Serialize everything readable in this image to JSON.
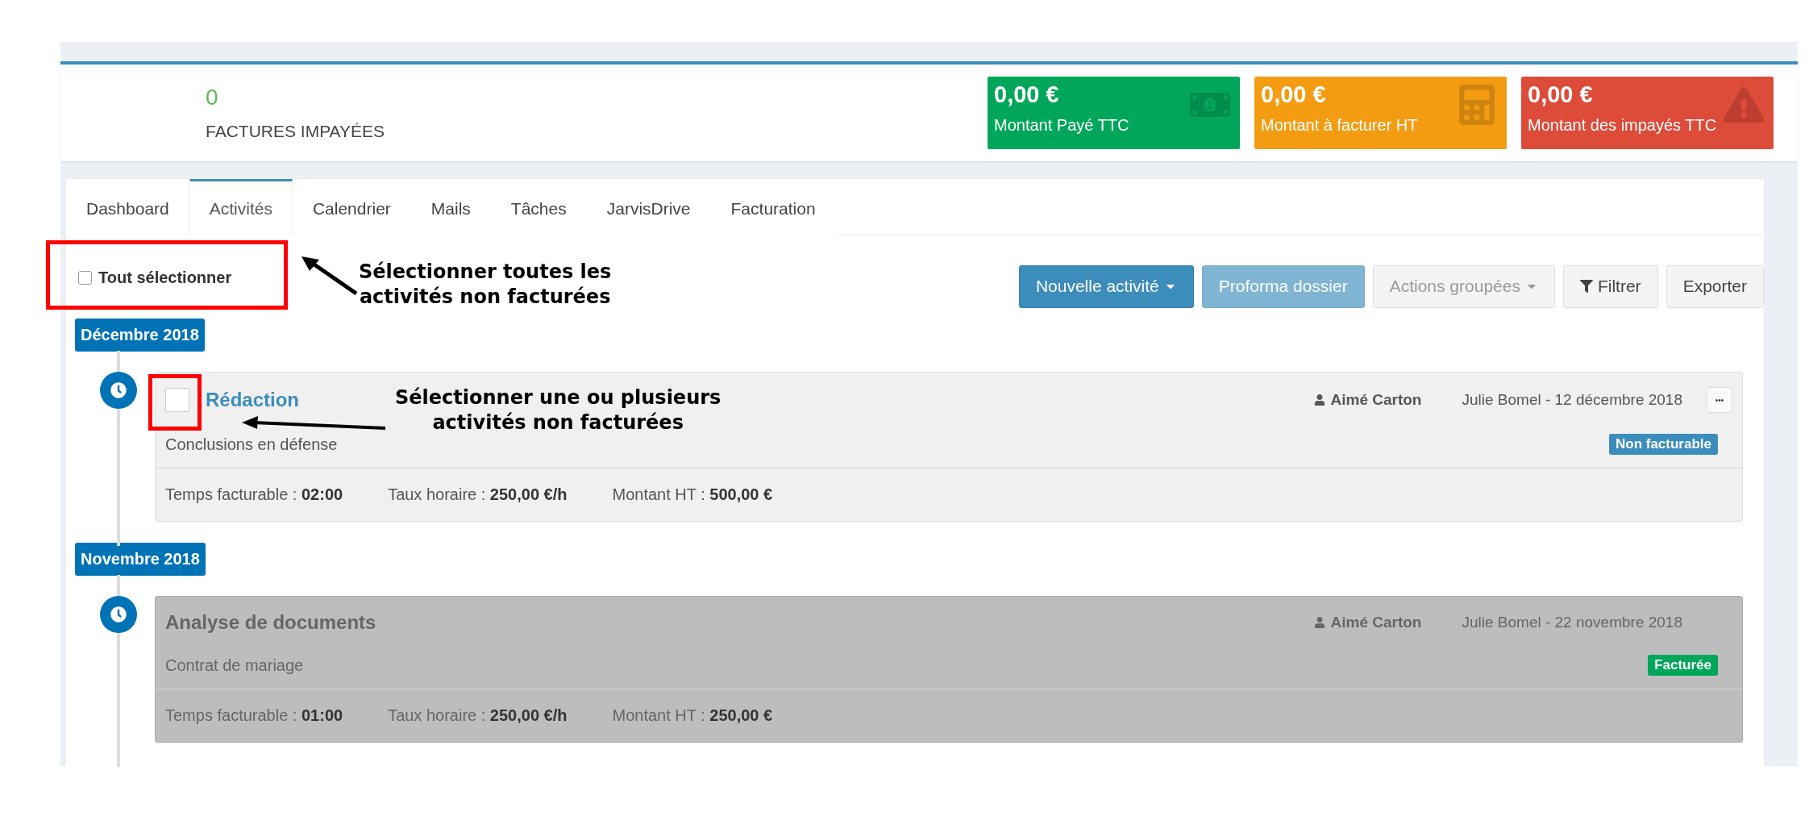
{
  "summary": {
    "count": "0",
    "label": "FACTURES IMPAYÉES"
  },
  "tiles": [
    {
      "value": "0,00 €",
      "label": "Montant Payé TTC",
      "kind": "money",
      "color": "#00a65a"
    },
    {
      "value": "0,00 €",
      "label": "Montant à facturer HT",
      "kind": "calculator",
      "color": "#f39c12"
    },
    {
      "value": "0,00 €",
      "label": "Montant des impayés TTC",
      "kind": "warning",
      "color": "#dd4b39"
    }
  ],
  "tabs": [
    {
      "label": "Dashboard",
      "selected": false
    },
    {
      "label": "Activités",
      "selected": true
    },
    {
      "label": "Calendrier",
      "selected": false
    },
    {
      "label": "Mails",
      "selected": false
    },
    {
      "label": "Tâches",
      "selected": false
    },
    {
      "label": "JarvisDrive",
      "selected": false
    },
    {
      "label": "Facturation",
      "selected": false
    }
  ],
  "select_all": {
    "label": "Tout sélectionner",
    "checked": false
  },
  "toolbar": [
    {
      "label": "Nouvelle activité",
      "kind": "primary",
      "dropdown": true,
      "disabled": false
    },
    {
      "label": "Proforma dossier",
      "kind": "primary",
      "dropdown": false,
      "disabled": true
    },
    {
      "label": "Actions groupées",
      "kind": "default",
      "dropdown": true,
      "disabled": true
    },
    {
      "label": "Filtrer",
      "kind": "filter",
      "dropdown": false,
      "disabled": false
    },
    {
      "label": "Exporter",
      "kind": "default",
      "dropdown": false,
      "disabled": false
    }
  ],
  "groups": [
    {
      "month": "Décembre 2018",
      "activities": [
        {
          "title": "Rédaction",
          "subtitle": "Conclusions en défense",
          "assignee": "Aimé Carton",
          "author_date": "Julie Bomel - 12 décembre 2018",
          "billed": false,
          "checked": false,
          "more": "•••",
          "status": {
            "label": "Non facturable",
            "color": "#3c8dbc"
          },
          "fields": [
            {
              "label": "Temps facturable : ",
              "value": "02:00"
            },
            {
              "label": "Taux horaire : ",
              "value": "250,00 €/h"
            },
            {
              "label": "Montant HT : ",
              "value": "500,00 €"
            }
          ]
        }
      ]
    },
    {
      "month": "Novembre 2018",
      "activities": [
        {
          "title": "Analyse de documents",
          "subtitle": "Contrat de mariage",
          "assignee": "Aimé Carton",
          "author_date": "Julie Bomel - 22 novembre 2018",
          "billed": true,
          "status": {
            "label": "Facturée",
            "color": "#00a65a"
          },
          "fields": [
            {
              "label": "Temps facturable : ",
              "value": "01:00"
            },
            {
              "label": "Taux horaire : ",
              "value": "250,00 €/h"
            },
            {
              "label": "Montant HT : ",
              "value": "250,00 €"
            }
          ]
        }
      ]
    }
  ],
  "annotations": [
    {
      "text": "Sélectionner toutes les activités non facturées"
    },
    {
      "text": "Sélectionner une ou plusieurs activités non facturées"
    }
  ]
}
